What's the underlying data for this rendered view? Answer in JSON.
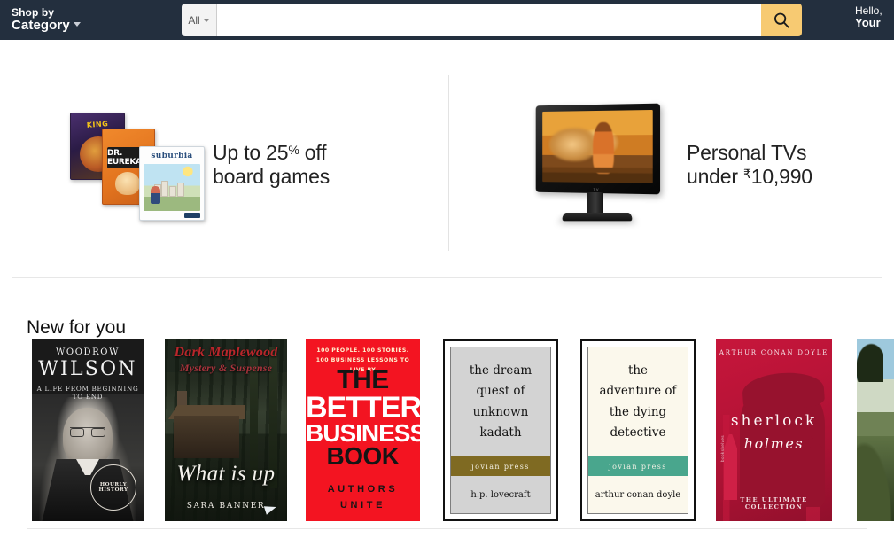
{
  "nav": {
    "shop_by_line1": "Shop by",
    "shop_by_line2": "Category",
    "search_scope": "All",
    "search_value": "",
    "search_placeholder": "",
    "search_icon": "search-icon",
    "search_button_color": "#f7ca72",
    "account_line1": "Hello,",
    "account_line2": "Your",
    "bar_color": "#232f3e"
  },
  "promos": [
    {
      "id": "board-games",
      "headline_line1_prefix": "Up to 25",
      "headline_line1_sup": "%",
      "headline_line1_suffix": " off",
      "headline_line2": "board games",
      "art": {
        "box1_title": "KING",
        "box2_title": "DR. EUREKA",
        "box3_title": "suburbia"
      }
    },
    {
      "id": "personal-tvs",
      "headline_line1": "Personal TVs",
      "headline_line2_prefix": "under ",
      "headline_line2_currency": "₹",
      "headline_line2_amount": "10,990",
      "art": {
        "brand": "TV"
      }
    }
  ],
  "new_for_you": {
    "title": "New for you",
    "books": [
      {
        "id": "woodrow-wilson",
        "line_sur": "WOODROW",
        "title": "WILSON",
        "subtitle": "A LIFE FROM BEGINNING TO END",
        "badge": "HOURLY HISTORY"
      },
      {
        "id": "dark-maplewood",
        "series": "Dark Maplewood",
        "genre": "Mystery & Suspense",
        "title": "What is up",
        "author": "SARA BANNER"
      },
      {
        "id": "better-business-book",
        "kicker": "100 PEOPLE. 100 STORIES. 100 BUSINESS LESSONS TO LIVE BY",
        "word1": "THE",
        "word2": "BETTER",
        "word3": "BUSINESS",
        "word4": "BOOK",
        "author_line1": "AUTHORS",
        "author_line2": "UNITE"
      },
      {
        "id": "dream-quest-unknown-kadath",
        "title": "the dream quest of unknown kadath",
        "publisher": "jovian press",
        "author": "h.p. lovecraft",
        "band_color": "#7f6a22",
        "bg_color": "#d3d3d3"
      },
      {
        "id": "adventure-dying-detective",
        "title": "the adventure of the dying detective",
        "publisher": "jovian press",
        "author": "arthur conan doyle",
        "band_color": "#49a68d",
        "bg_color": "#fbf8ec"
      },
      {
        "id": "sherlock-holmes",
        "author": "ARTHUR CONAN DOYLE",
        "title_first": "sherlock",
        "title_second": "holmes",
        "tagline": "THE ULTIMATE COLLECTION",
        "spine": "bookshelves",
        "bg_color": "#b01235"
      },
      {
        "id": "landscape-book",
        "title": ""
      }
    ]
  }
}
